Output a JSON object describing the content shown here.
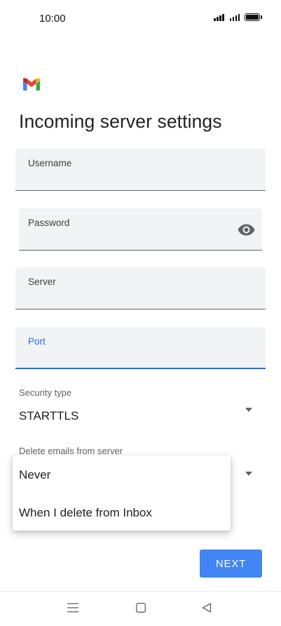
{
  "status_bar": {
    "time": "10:00"
  },
  "app": {
    "logo_icon": "gmail-logo-icon",
    "title": "Incoming server settings"
  },
  "fields": {
    "username": {
      "label": "Username",
      "value": ""
    },
    "password": {
      "label": "Password",
      "value": "",
      "icon": "eye-icon"
    },
    "server": {
      "label": "Server",
      "value": ""
    },
    "port": {
      "label": "Port",
      "value": "",
      "focused": true
    }
  },
  "security_type": {
    "label": "Security type",
    "value": "STARTTLS"
  },
  "delete_emails": {
    "label": "Delete emails from server",
    "options": [
      "Never",
      "When I delete from Inbox"
    ]
  },
  "actions": {
    "next_label": "NEXT"
  },
  "colors": {
    "accent": "#1a73e8",
    "button": "#4285f4",
    "field_background": "#f1f3f4"
  },
  "nav_bar": {
    "icons": [
      "menu-icon",
      "home-square-icon",
      "back-triangle-icon"
    ]
  }
}
